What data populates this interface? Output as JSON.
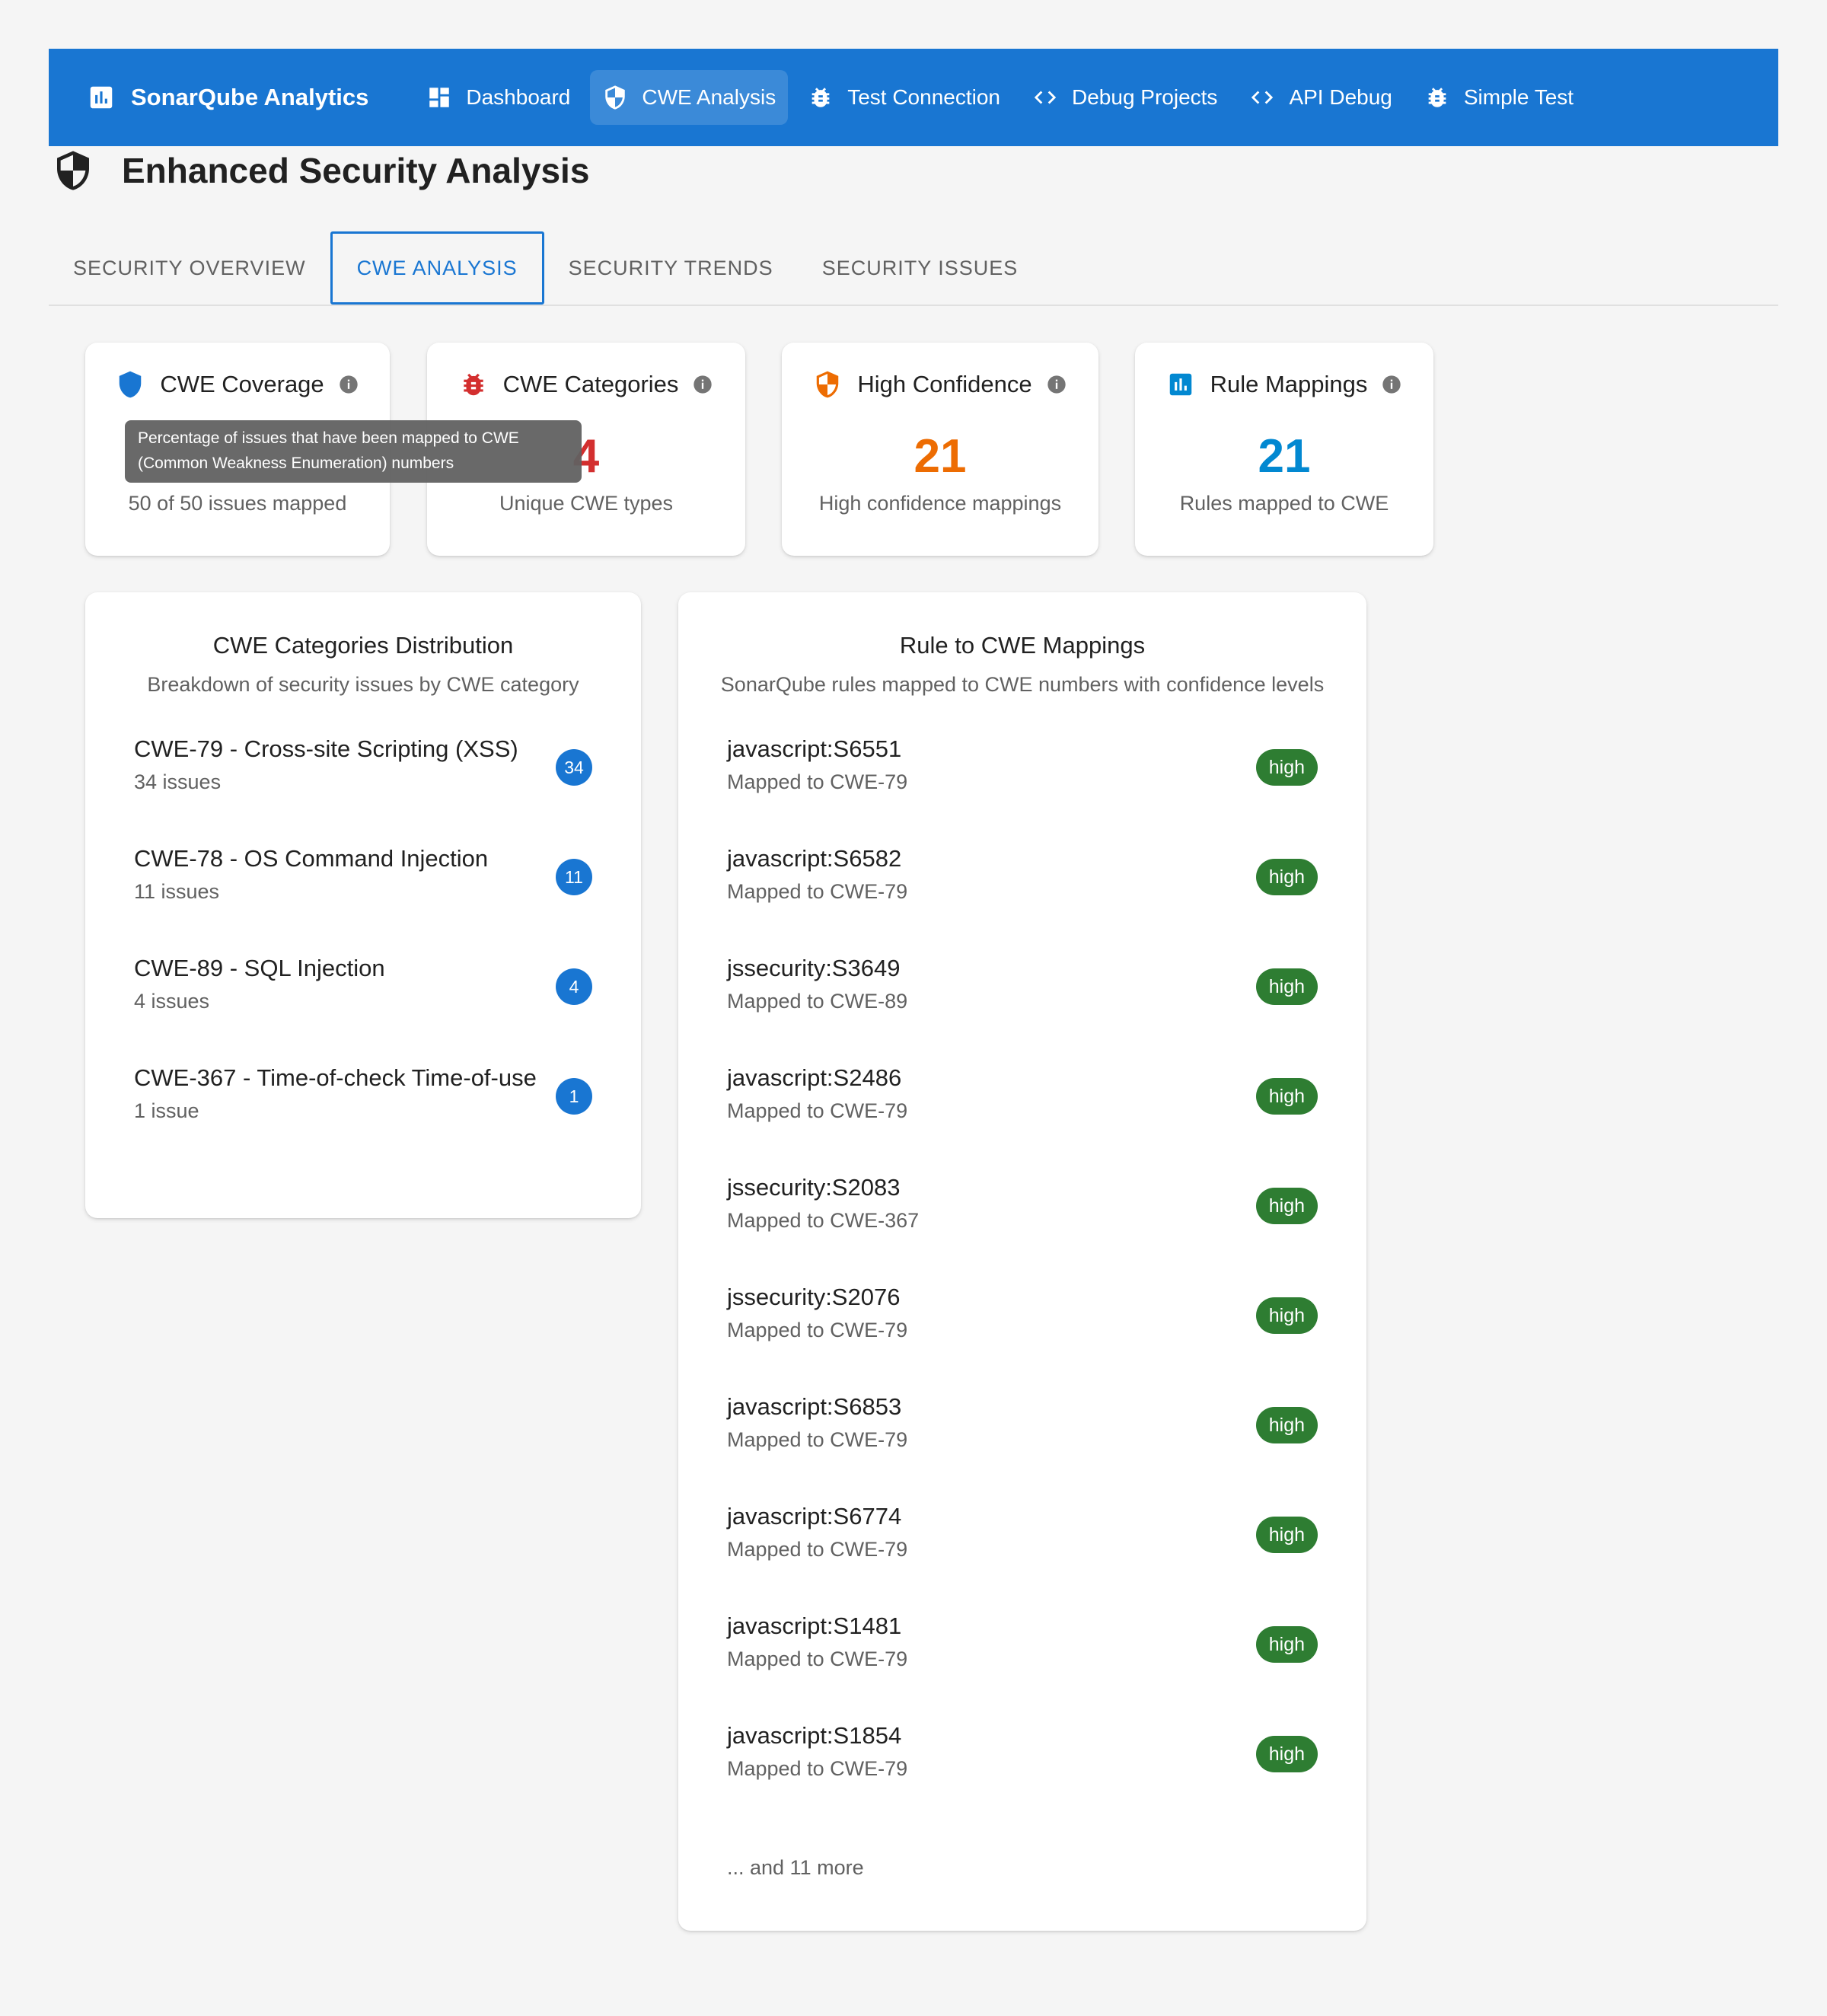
{
  "appbar": {
    "brand": "SonarQube Analytics",
    "nav": [
      {
        "label": "Dashboard",
        "icon": "dashboard-icon"
      },
      {
        "label": "CWE Analysis",
        "icon": "shield-icon",
        "active": true
      },
      {
        "label": "Test Connection",
        "icon": "bug-icon"
      },
      {
        "label": "Debug Projects",
        "icon": "code-icon"
      },
      {
        "label": "API Debug",
        "icon": "code-icon"
      },
      {
        "label": "Simple Test",
        "icon": "bug-icon"
      }
    ],
    "color": "#1976d2"
  },
  "page": {
    "title": "Enhanced Security Analysis"
  },
  "tabs": [
    {
      "label": "SECURITY OVERVIEW"
    },
    {
      "label": "CWE ANALYSIS",
      "active": true
    },
    {
      "label": "SECURITY TRENDS"
    },
    {
      "label": "SECURITY ISSUES"
    }
  ],
  "stats": {
    "coverage": {
      "title": "CWE Coverage",
      "value": "",
      "sub": "50 of 50 issues mapped",
      "color": "#1976d2"
    },
    "categories": {
      "title": "CWE Categories",
      "value": "4",
      "sub": "Unique CWE types",
      "color": "#d32f2f"
    },
    "confidence": {
      "title": "High Confidence",
      "value": "21",
      "sub": "High confidence mappings",
      "color": "#ed6c02"
    },
    "rules": {
      "title": "Rule Mappings",
      "value": "21",
      "sub": "Rules mapped to CWE",
      "color": "#0288d1"
    }
  },
  "tooltip": {
    "line1": "Percentage of issues that have been mapped to CWE",
    "line2": "(Common Weakness Enumeration) numbers"
  },
  "distribution": {
    "title": "CWE Categories Distribution",
    "subtitle": "Breakdown of security issues by CWE category",
    "items": [
      {
        "name": "CWE-79 - Cross-site Scripting (XSS)",
        "count_label": "34 issues",
        "badge": "34"
      },
      {
        "name": "CWE-78 - OS Command Injection",
        "count_label": "11 issues",
        "badge": "11"
      },
      {
        "name": "CWE-89 - SQL Injection",
        "count_label": "4 issues",
        "badge": "4"
      },
      {
        "name": "CWE-367 - Time-of-check Time-of-use",
        "count_label": "1 issue",
        "badge": "1"
      }
    ]
  },
  "mappings": {
    "title": "Rule to CWE Mappings",
    "subtitle": "SonarQube rules mapped to CWE numbers with confidence levels",
    "items": [
      {
        "rule": "javascript:S6551",
        "cwe": "Mapped to CWE-79",
        "confidence": "high"
      },
      {
        "rule": "javascript:S6582",
        "cwe": "Mapped to CWE-79",
        "confidence": "high"
      },
      {
        "rule": "jssecurity:S3649",
        "cwe": "Mapped to CWE-89",
        "confidence": "high"
      },
      {
        "rule": "javascript:S2486",
        "cwe": "Mapped to CWE-79",
        "confidence": "high"
      },
      {
        "rule": "jssecurity:S2083",
        "cwe": "Mapped to CWE-367",
        "confidence": "high"
      },
      {
        "rule": "jssecurity:S2076",
        "cwe": "Mapped to CWE-79",
        "confidence": "high"
      },
      {
        "rule": "javascript:S6853",
        "cwe": "Mapped to CWE-79",
        "confidence": "high"
      },
      {
        "rule": "javascript:S6774",
        "cwe": "Mapped to CWE-79",
        "confidence": "high"
      },
      {
        "rule": "javascript:S1481",
        "cwe": "Mapped to CWE-79",
        "confidence": "high"
      },
      {
        "rule": "javascript:S1854",
        "cwe": "Mapped to CWE-79",
        "confidence": "high"
      }
    ],
    "more": "... and 11 more"
  }
}
